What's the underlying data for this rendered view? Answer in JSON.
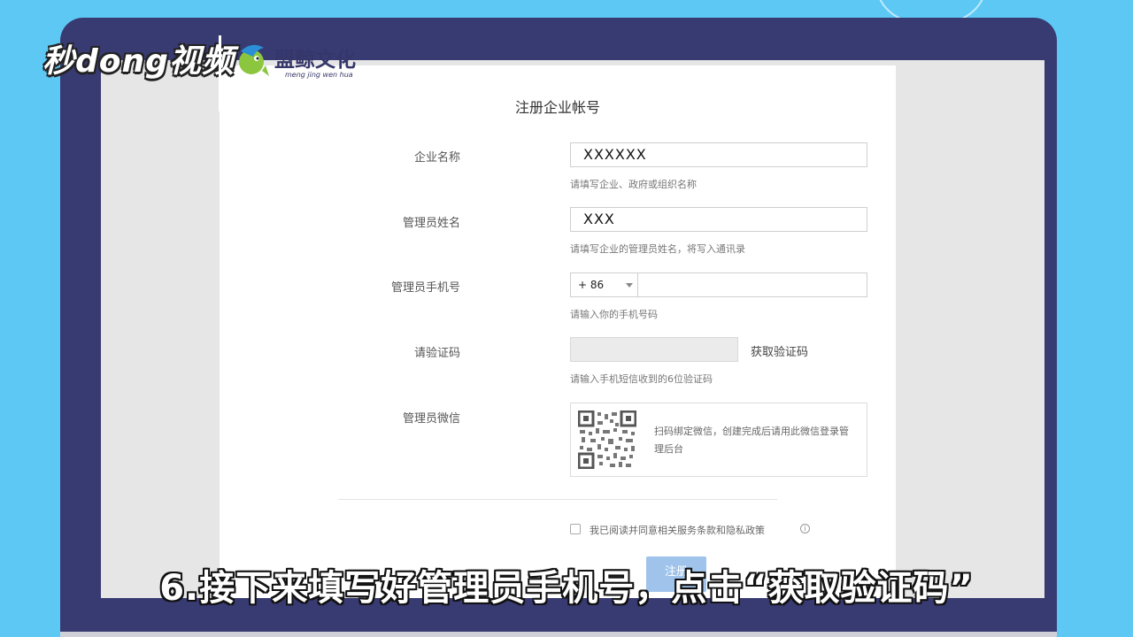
{
  "watermark": {
    "left_logo": "秒dong视频",
    "right_logo": "盟鲸文化",
    "right_logo_sub": "meng jing wen hua"
  },
  "form": {
    "title": "注册企业帐号",
    "company": {
      "label": "企业名称",
      "value": "XXXXXX",
      "hint": "请填写企业、政府或组织名称"
    },
    "admin_name": {
      "label": "管理员姓名",
      "value": "XXX",
      "hint": "请填写企业的管理员姓名，将写入通讯录"
    },
    "phone": {
      "label": "管理员手机号",
      "country_code": "+ 86",
      "value": "",
      "hint": "请输入你的手机号码"
    },
    "sms": {
      "label": "请验证码",
      "value": "",
      "get_code_label": "获取验证码",
      "hint": "请输入手机短信收到的6位验证码"
    },
    "wechat": {
      "label": "管理员微信",
      "text": "扫码绑定微信，创建完成后请用此微信登录管理后台"
    },
    "agreement": {
      "text": "我已阅读并同意相关服务条款和隐私政策",
      "info_glyph": "i"
    },
    "register_label": "注册"
  },
  "caption": "6.接下来填写好管理员手机号，点击“获取验证码”",
  "colors": {
    "background": "#5ec8f5",
    "laptop_frame": "#383a72",
    "button": "#9fc3ea"
  }
}
